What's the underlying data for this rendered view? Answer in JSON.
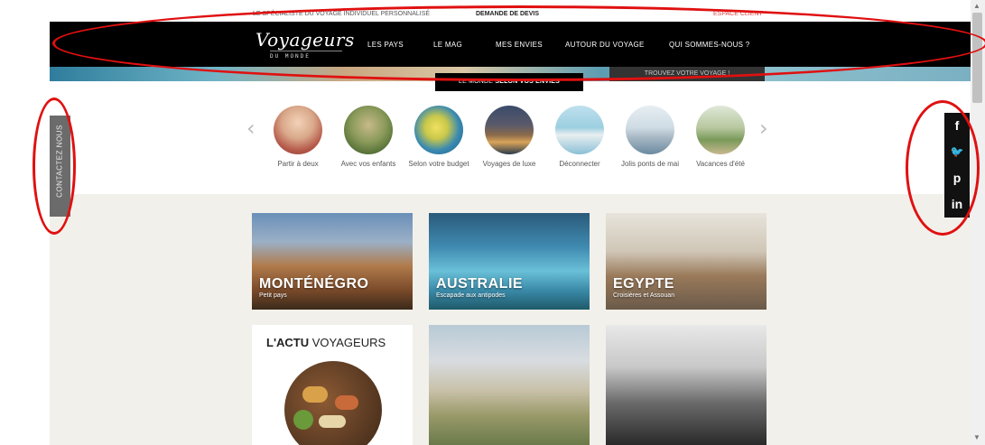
{
  "topbar": {
    "tagline": "LE SPÉCIALISTE DU VOYAGE INDIVIDUEL PERSONNALISÉ",
    "quote": "DEMANDE DE DEVIS",
    "client": "ESPACE CLIENT"
  },
  "logo": {
    "name": "Voyageurs",
    "sub": "DU MONDE"
  },
  "nav": [
    "LES PAYS",
    "LE MAG",
    "MES ENVIES",
    "AUTOUR DU VOYAGE",
    "QUI SOMMES-NOUS ?"
  ],
  "hero": {
    "dark_button": "TROUVEZ VOTRE VOYAGE !",
    "monde_prefix": "LE MONDE",
    "monde_bold": "SELON VOS ENVIES"
  },
  "envies": [
    {
      "label": "Partir à deux",
      "icon": "couple-room-photo"
    },
    {
      "label": "Avec vos enfants",
      "icon": "family-garden-photo"
    },
    {
      "label": "Selon votre budget",
      "icon": "lemons-photo"
    },
    {
      "label": "Voyages de luxe",
      "icon": "luxury-villa-photo"
    },
    {
      "label": "Déconnecter",
      "icon": "boat-sea-photo"
    },
    {
      "label": "Jolis ponts de mai",
      "icon": "harbor-city-photo"
    },
    {
      "label": "Vacances d'été",
      "icon": "beach-walk-photo"
    }
  ],
  "tiles": [
    {
      "title": "MONTÉNÉGRO",
      "subtitle": "Petit pays"
    },
    {
      "title": "AUSTRALIE",
      "subtitle": "Escapade aux antipodes"
    },
    {
      "title": "EGYPTE",
      "subtitle": "Croisières et Assouan"
    }
  ],
  "actu": {
    "bold": "L'ACTU",
    "rest": "VOYAGEURS"
  },
  "contact": "CONTACTEZ NOUS",
  "social": [
    {
      "name": "facebook",
      "glyph": "f"
    },
    {
      "name": "twitter",
      "glyph": "🐦"
    },
    {
      "name": "pinterest",
      "glyph": "p"
    },
    {
      "name": "linkedin",
      "glyph": "in"
    }
  ],
  "colors": {
    "annotation": "#e01010",
    "navbar": "#000000",
    "beige": "#f2f0ea"
  }
}
